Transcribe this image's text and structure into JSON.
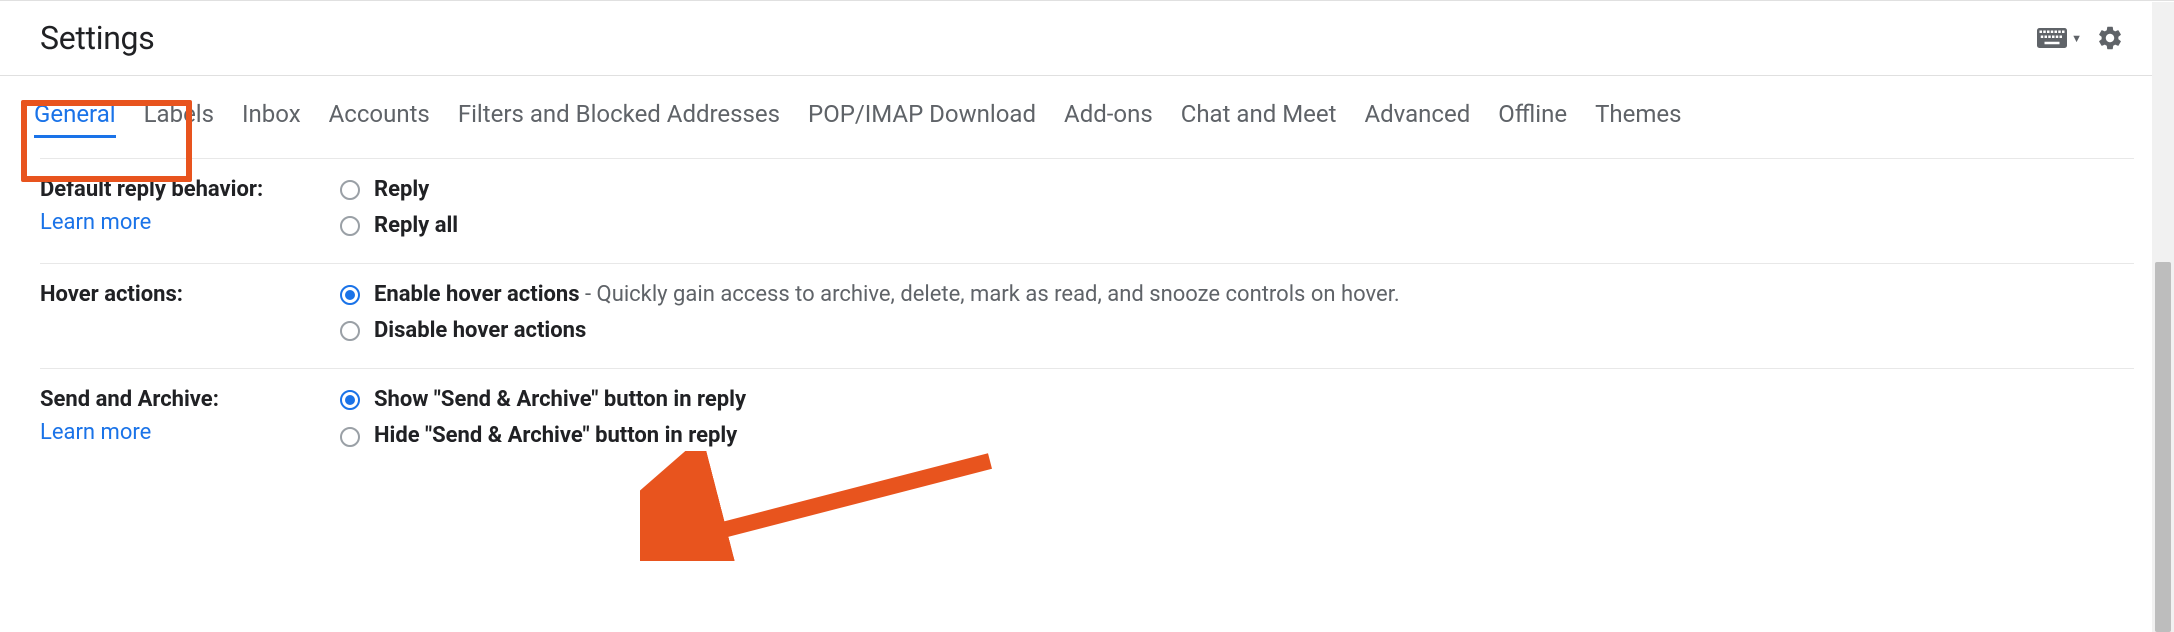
{
  "header": {
    "title": "Settings"
  },
  "tabs": {
    "items": [
      {
        "label": "General",
        "active": true
      },
      {
        "label": "Labels"
      },
      {
        "label": "Inbox"
      },
      {
        "label": "Accounts"
      },
      {
        "label": "Filters and Blocked Addresses"
      },
      {
        "label": "POP/IMAP Download"
      },
      {
        "label": "Add-ons"
      },
      {
        "label": "Chat and Meet"
      },
      {
        "label": "Advanced"
      },
      {
        "label": "Offline"
      },
      {
        "label": "Themes"
      }
    ]
  },
  "settings": {
    "default_reply": {
      "label": "Default reply behavior:",
      "learn_more": "Learn more",
      "options": [
        {
          "label": "Reply",
          "checked": false
        },
        {
          "label": "Reply all",
          "checked": false
        }
      ]
    },
    "hover_actions": {
      "label": "Hover actions:",
      "options": [
        {
          "label": "Enable hover actions",
          "desc": " - Quickly gain access to archive, delete, mark as read, and snooze controls on hover.",
          "checked": true
        },
        {
          "label": "Disable hover actions",
          "checked": false
        }
      ]
    },
    "send_archive": {
      "label": "Send and Archive:",
      "learn_more": "Learn more",
      "options": [
        {
          "label": "Show \"Send & Archive\" button in reply",
          "checked": true
        },
        {
          "label": "Hide \"Send & Archive\" button in reply",
          "checked": false
        }
      ]
    }
  },
  "annotations": {
    "highlight_tab": "General",
    "arrow_target": "Show \"Send & Archive\" button in reply"
  }
}
